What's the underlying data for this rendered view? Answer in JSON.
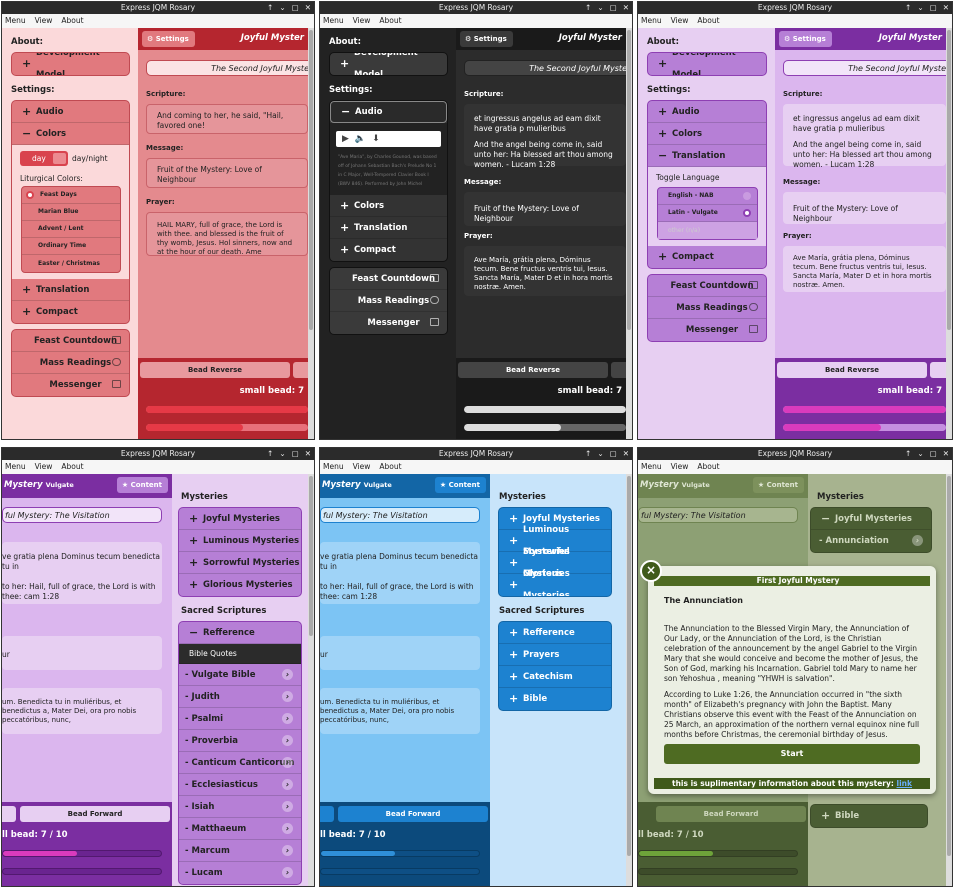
{
  "window_title": "Express JQM Rosary",
  "window_controls": [
    "↑",
    "⌄",
    "▢",
    "✕"
  ],
  "menu": [
    "Menu",
    "View",
    "About"
  ],
  "about_header": "About:",
  "dev_model": "Development Model",
  "settings_header": "Settings:",
  "audio": "Audio",
  "colors": "Colors",
  "translation": "Translation",
  "compact": "Compact",
  "feast_countdown": "Feast Countdown",
  "mass_readings": "Mass Readings",
  "messenger": "Messenger",
  "settings_btn": "Settings",
  "content_btn": "Content",
  "title_right": "Joyful Myster",
  "title_left": "Mystery",
  "title_left_sub": "Vulgate",
  "mystery_name": "The Second Joyful Myste",
  "mystery_visitation": "ful Mystery: The Visitation",
  "scripture_lbl": "Scripture:",
  "message_lbl": "Message:",
  "prayer_lbl": "Prayer:",
  "scripture_en": "And coming to her, he said, \"Hail, favored one!",
  "scripture_latin": "et ingressus angelus ad eam dixit have gratia p mulieribus",
  "scripture_en2": "And the angel being come in, said unto her: Ha blessed art thou among women. - Lucam 1:28",
  "scripture_cut1": "ve gratia plena Dominus tecum benedicta tu in",
  "scripture_cut2": "to her: Hail, full of grace, the Lord is with thee: cam 1:28",
  "message_text": "Fruit of the Mystery: Love of Neighbour",
  "message_cut": "ur",
  "prayer_en": "HAIL MARY, full of grace, the Lord is with thee. and blessed is the fruit of thy womb, Jesus. Hol sinners, now and at the hour of our death. Ame",
  "prayer_latin": "Ave María, grátia plena, Dóminus tecum. Bene fructus ventris tui, Iesus. Sancta María, Mater D et in hora mortis nostræ. Amen.",
  "prayer_cut": "um. Benedicta tu in muliéribus, et benedictus a, Mater Dei, ora pro nobis peccatóribus, nunc,",
  "bead_reverse": "Bead Reverse",
  "bead_forward": "Bead Forward",
  "small_bead": "small bead: 7",
  "small_bead_full": "ll bead: 7 / 10",
  "day": "day",
  "day_night": "day/night",
  "liturgical_colors": "Liturgical Colors:",
  "colors_list": [
    "Feast Days",
    "Marian Blue",
    "Advent / Lent",
    "Ordinary Time",
    "Easter / Christmas"
  ],
  "toggle_language": "Toggle Language",
  "languages": [
    "English - NAB",
    "Latin - Vulgate",
    "other (n/a)"
  ],
  "audio_caption": "\"Ave Maria\", by Charles Gounod, was based off of Johann Sebastian Bach's Prelude No 1 in C Major, Well-Tempered Clavier Book I (BWV 846). Performed by John Michel",
  "mysteries_header": "Mysteries",
  "mysteries": [
    "Joyful Mysteries",
    "Luminous Mysteries",
    "Sorrowful Mysteries",
    "Glorious Mysteries"
  ],
  "sacred_scriptures": "Sacred Scriptures",
  "refference": "Refference",
  "bible_quotes": "Bible Quotes",
  "bible_list": [
    "- Vulgate Bible",
    "- Judith",
    "- Psalmi",
    "- Proverbia",
    "- Canticum Canticorum",
    "- Ecclesiasticus",
    "- Isiah",
    "- Matthaeum",
    "- Marcum",
    "- Lucam"
  ],
  "scripture_links": [
    "Refference",
    "Prayers",
    "Catechism",
    "Bible"
  ],
  "annunciation": "- Annunciation",
  "popup": {
    "title": "First Joyful Mystery",
    "heading": "The Annunciation",
    "p1": "The Annunciation to the Blessed Virgin Mary, the Annunciation of Our Lady, or the Annunciation of the Lord, is the Christian celebration of the announcement by the angel Gabriel to the Virgin Mary that she would conceive and become the mother of Jesus, the Son of God, marking his Incarnation. Gabriel told Mary to name her son Yehoshua , meaning \"YHWH is salvation\".",
    "p2": "According to Luke 1:26, the Annunciation occurred in \"the sixth month\" of Elizabeth's pregnancy with John the Baptist. Many Christians observe this event with the Feast of the Annunciation on 25 March, an approximation of the northern vernal equinox nine full months before Christmas, the ceremonial birthday of Jesus.",
    "start": "Start",
    "footer": "this is suplimentary information about this mystery:",
    "link": "link",
    "close": "×"
  },
  "progress": {
    "small_bead": 0.7,
    "decade": 0.3
  },
  "colors_theme": {
    "red": "#d9434e",
    "dark": "#2b2b2b",
    "purple": "#8e3fb3",
    "blue": "#1d82d0",
    "green": "#4e6b22"
  }
}
